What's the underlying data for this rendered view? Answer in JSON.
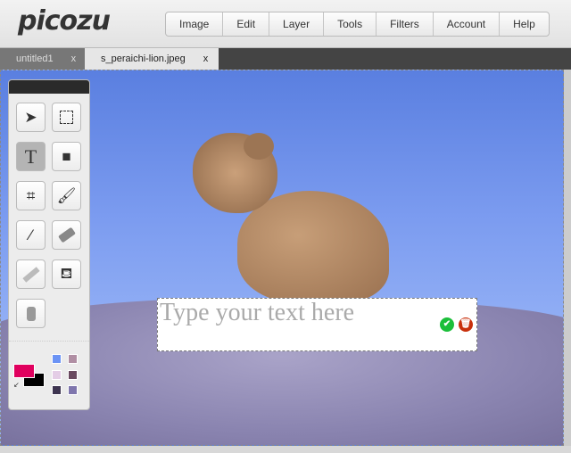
{
  "app": {
    "logo": "picozu"
  },
  "menu": [
    "Image",
    "Edit",
    "Layer",
    "Tools",
    "Filters",
    "Account",
    "Help"
  ],
  "tabs": [
    {
      "label": "untitled1",
      "close": "x"
    },
    {
      "label": "s_peraichi-lion.jpeg",
      "close": "x"
    }
  ],
  "textbox": {
    "placeholder": "Type your text here"
  },
  "colors": {
    "primary": "#e0005e",
    "secondary": "#000000",
    "swatches": [
      "#6b93f5",
      "#b08ea3",
      "#e4cde6",
      "#6a4a60",
      "#3d3450",
      "#7f76ad"
    ]
  }
}
